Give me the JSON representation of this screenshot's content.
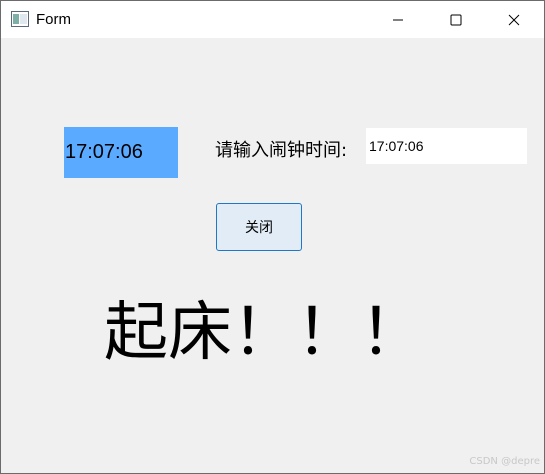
{
  "window": {
    "title": "Form",
    "icon": "app-window-icon",
    "controls": [
      "minimize-icon",
      "maximize-icon",
      "close-icon"
    ]
  },
  "clock": {
    "current_time": "17:07:06",
    "background_color": "#5aaaff"
  },
  "alarm": {
    "prompt": "请输入闹钟时间:",
    "input_value": "17:07:06"
  },
  "close_button": {
    "label": "关闭"
  },
  "message": {
    "text": "起床！！！"
  },
  "watermark": {
    "text": "CSDN @depre"
  }
}
